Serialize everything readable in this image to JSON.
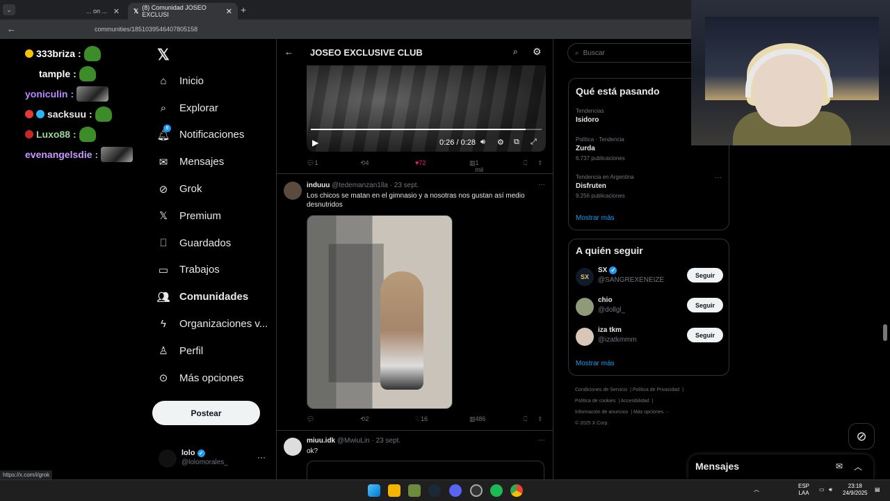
{
  "browser": {
    "tabs": [
      {
        "label": "... on ..."
      },
      {
        "label": "(8) Comunidad JOSEO EXCLUSI"
      }
    ],
    "url": "communities/1851039546407805158",
    "status_url": "https://x.com/i/grok"
  },
  "chat": [
    {
      "user": "333briza",
      "color": "#ffffff"
    },
    {
      "user": "tample",
      "color": "#ffffff"
    },
    {
      "user": "yoniculin",
      "color": "#b78bff"
    },
    {
      "user": "sacksuu",
      "color": "#e7e9ea"
    },
    {
      "user": "Luxo88",
      "color": "#9bd59b"
    },
    {
      "user": "evenangelsdie",
      "color": "#c79bff"
    }
  ],
  "nav": {
    "items": [
      {
        "label": "Inicio",
        "icon": "home-icon"
      },
      {
        "label": "Explorar",
        "icon": "search-icon"
      },
      {
        "label": "Notificaciones",
        "icon": "bell-icon"
      },
      {
        "label": "Mensajes",
        "icon": "mail-icon"
      },
      {
        "label": "Grok",
        "icon": "grok-icon"
      },
      {
        "label": "Premium",
        "icon": "x-icon"
      },
      {
        "label": "Guardados",
        "icon": "bookmark-icon"
      },
      {
        "label": "Trabajos",
        "icon": "briefcase-icon"
      },
      {
        "label": "Comunidades",
        "icon": "communities-icon"
      },
      {
        "label": "Organizaciones v...",
        "icon": "lightning-icon"
      },
      {
        "label": "Perfil",
        "icon": "person-icon"
      },
      {
        "label": "Más opciones",
        "icon": "more-circle-icon"
      }
    ],
    "notification_badge": "8",
    "post_label": "Postear",
    "profile": {
      "name": "lolo",
      "handle": "@lolomorales_"
    }
  },
  "main": {
    "title": "JOSEO EXCLUSIVE CLUB",
    "video": {
      "time": "0:26 / 0:28",
      "progress": 0.93
    },
    "tweet1_actions": {
      "replies": "1",
      "retweets": "4",
      "likes": "72",
      "views": "1 mil"
    },
    "tweet2": {
      "name": "induuu",
      "meta": "@tedemanzan1lla · 23 sept.",
      "text": "Los chicos se matan en el gimnasio y a nosotras nos gustan así medio desnutridos",
      "actions": {
        "retweets": "2",
        "likes": "16",
        "views": "486"
      }
    },
    "tweet3": {
      "name": "miuu.idk",
      "meta": "@MwiuLin · 23 sept.",
      "text": "ok?"
    }
  },
  "right": {
    "search_placeholder": "Buscar",
    "trending": {
      "title": "Qué está pasando",
      "items": [
        {
          "category": "Tendencias",
          "name": "Isidoro",
          "count": ""
        },
        {
          "category": "Política · Tendencia",
          "name": "Zurda",
          "count": "6.737 publicaciones"
        },
        {
          "category": "Tendencia en Argentina",
          "name": "Disfruten",
          "count": "9.256 publicaciones"
        }
      ],
      "show_more": "Mostrar más"
    },
    "who_to_follow": {
      "title": "A quién seguir",
      "items": [
        {
          "name": "SX",
          "handle": "@SANGREXENEIZE",
          "verified": true,
          "button": "Seguir"
        },
        {
          "name": "chio",
          "handle": "@dollgl_",
          "verified": false,
          "button": "Seguir"
        },
        {
          "name": "iza tkm",
          "handle": "@izatkmmm",
          "verified": false,
          "button": "Seguir"
        }
      ],
      "show_more": "Mostrar más"
    },
    "footer": [
      "Condiciones de Servicio",
      "Política de Privacidad",
      "Política de cookies",
      "Accesibilidad",
      "Información de anuncios",
      "Más opciones ···",
      "© 2025 X Corp."
    ]
  },
  "messages_drawer": {
    "title": "Mensajes"
  },
  "taskbar": {
    "lang1": "ESP",
    "lang2": "LAA",
    "time": "23:18",
    "date": "24/9/2025"
  },
  "colors": {
    "accent": "#1d9bf0",
    "like": "#f91880",
    "background": "#000000"
  }
}
